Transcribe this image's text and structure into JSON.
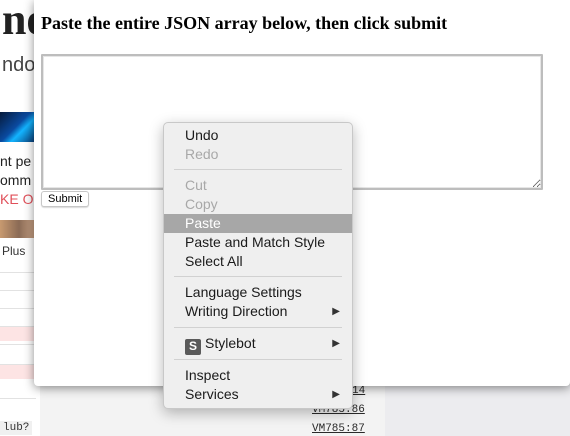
{
  "background": {
    "big_title_fragment": "ne",
    "sub_fragment": "ndor",
    "lines": [
      "nt pe",
      "omm",
      "KE OU"
    ],
    "plus_label": "Plus",
    "console_fragment": "lub?",
    "links": [
      "14",
      "VM785:86",
      "VM785:87"
    ]
  },
  "modal": {
    "title": "Paste the entire JSON array below, then click submit",
    "textarea_value": "",
    "submit_label": "Submit"
  },
  "context_menu": {
    "items": [
      {
        "label": "Undo",
        "enabled": true
      },
      {
        "label": "Redo",
        "enabled": false
      },
      {
        "label": "Cut",
        "enabled": false
      },
      {
        "label": "Copy",
        "enabled": false
      },
      {
        "label": "Paste",
        "enabled": true,
        "highlighted": true
      },
      {
        "label": "Paste and Match Style",
        "enabled": true
      },
      {
        "label": "Select All",
        "enabled": true
      },
      {
        "label": "Language Settings",
        "enabled": true
      },
      {
        "label": "Writing Direction",
        "enabled": true,
        "submenu": true
      },
      {
        "label": "Stylebot",
        "enabled": true,
        "submenu": true,
        "icon_letter": "S"
      },
      {
        "label": "Inspect",
        "enabled": true
      },
      {
        "label": "Services",
        "enabled": true,
        "submenu": true
      }
    ]
  },
  "colors": {
    "menu_highlight": "#a7a7a7",
    "menu_background": "#efefef",
    "background_red_text": "#e0505a"
  }
}
